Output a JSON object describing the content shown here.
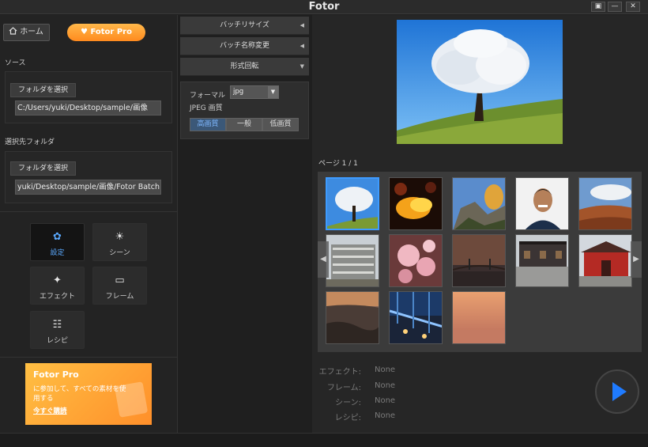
{
  "window": {
    "title": "Fotor",
    "restore_label": "▣",
    "minimize_label": "—",
    "close_label": "✕"
  },
  "sidebar": {
    "home_label": "ホーム",
    "pro_label": "Fotor Pro",
    "source_label": "ソース",
    "source_button": "フォルダを選択",
    "source_path": "C:/Users/yuki/Desktop/sample/画像",
    "dest_label": "選択先フォルダ",
    "dest_button": "フォルダを選択",
    "dest_path": "yuki/Desktop/sample/画像/Fotor Batch",
    "tools": [
      {
        "label": "設定",
        "icon": "gear-icon",
        "active": true
      },
      {
        "label": "シーン",
        "icon": "sun-icon",
        "active": false
      },
      {
        "label": "エフェクト",
        "icon": "sparkle-icon",
        "active": false
      },
      {
        "label": "フレーム",
        "icon": "frame-icon",
        "active": false
      },
      {
        "label": "レシピ",
        "icon": "recipe-icon",
        "active": false
      }
    ],
    "promo": {
      "title": "Fotor Pro",
      "text": "に参加して、すべての素材を使用する",
      "cta": "今すぐ購読"
    }
  },
  "settings": {
    "sections": [
      "バッチリサイズ",
      "バッチ名称変更",
      "形式回転"
    ],
    "format_label": "フォーマル",
    "format_value": "jpg",
    "jpeg_quality_label": "JPEG 画質",
    "quality_options": [
      "高画質",
      "一般",
      "低画質"
    ],
    "quality_selected": "高画質"
  },
  "gallery": {
    "page_label": "ページ 1 / 1",
    "thumbnails": [
      "tree",
      "fire",
      "rocks",
      "portrait",
      "autumn",
      "building",
      "blossom",
      "bridge",
      "street",
      "shrine",
      "coast",
      "city-bridge",
      "sunset"
    ],
    "selected_index": 0
  },
  "summary": {
    "items": [
      {
        "label": "エフェクト:",
        "value": "None"
      },
      {
        "label": "フレーム:",
        "value": "None"
      },
      {
        "label": "シーン:",
        "value": "None"
      },
      {
        "label": "レシピ:",
        "value": "None"
      }
    ]
  },
  "colors": {
    "accent": "#3e9bff",
    "pro_orange": "#ff8a1e",
    "play_blue": "#1f7bff"
  }
}
